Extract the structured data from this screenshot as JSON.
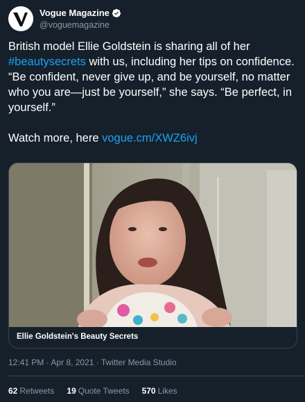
{
  "account": {
    "display_name": "Vogue Magazine",
    "handle": "@voguemagazine",
    "avatar_icon": "vogue-v-logo-icon",
    "verified_icon": "verified-badge-icon"
  },
  "tweet": {
    "text_before_hashtag": "British model Ellie Goldstein is sharing all of her\n",
    "hashtag": "#beautysecrets",
    "text_after_hashtag": " with us, including her tips on confidence.\n“Be confident, never give up, and be yourself, no matter who you are—just be yourself,” she says. “Be perfect, in yourself.”\n\nWatch more, here ",
    "link": "vogue.cm/XWZ6ivj"
  },
  "media": {
    "title": "Ellie Goldstein's Beauty Secrets"
  },
  "meta": {
    "time": "12:41 PM",
    "date": "Apr 8, 2021",
    "source": "Twitter Media Studio",
    "separator": " · "
  },
  "stats": {
    "retweets_count": "62",
    "retweets_label": "Retweets",
    "quotes_count": "19",
    "quotes_label": "Quote Tweets",
    "likes_count": "570",
    "likes_label": "Likes"
  },
  "colors": {
    "background": "#15202b",
    "link": "#1da1f2",
    "secondary_text": "#8899a6",
    "border": "#38444d"
  }
}
